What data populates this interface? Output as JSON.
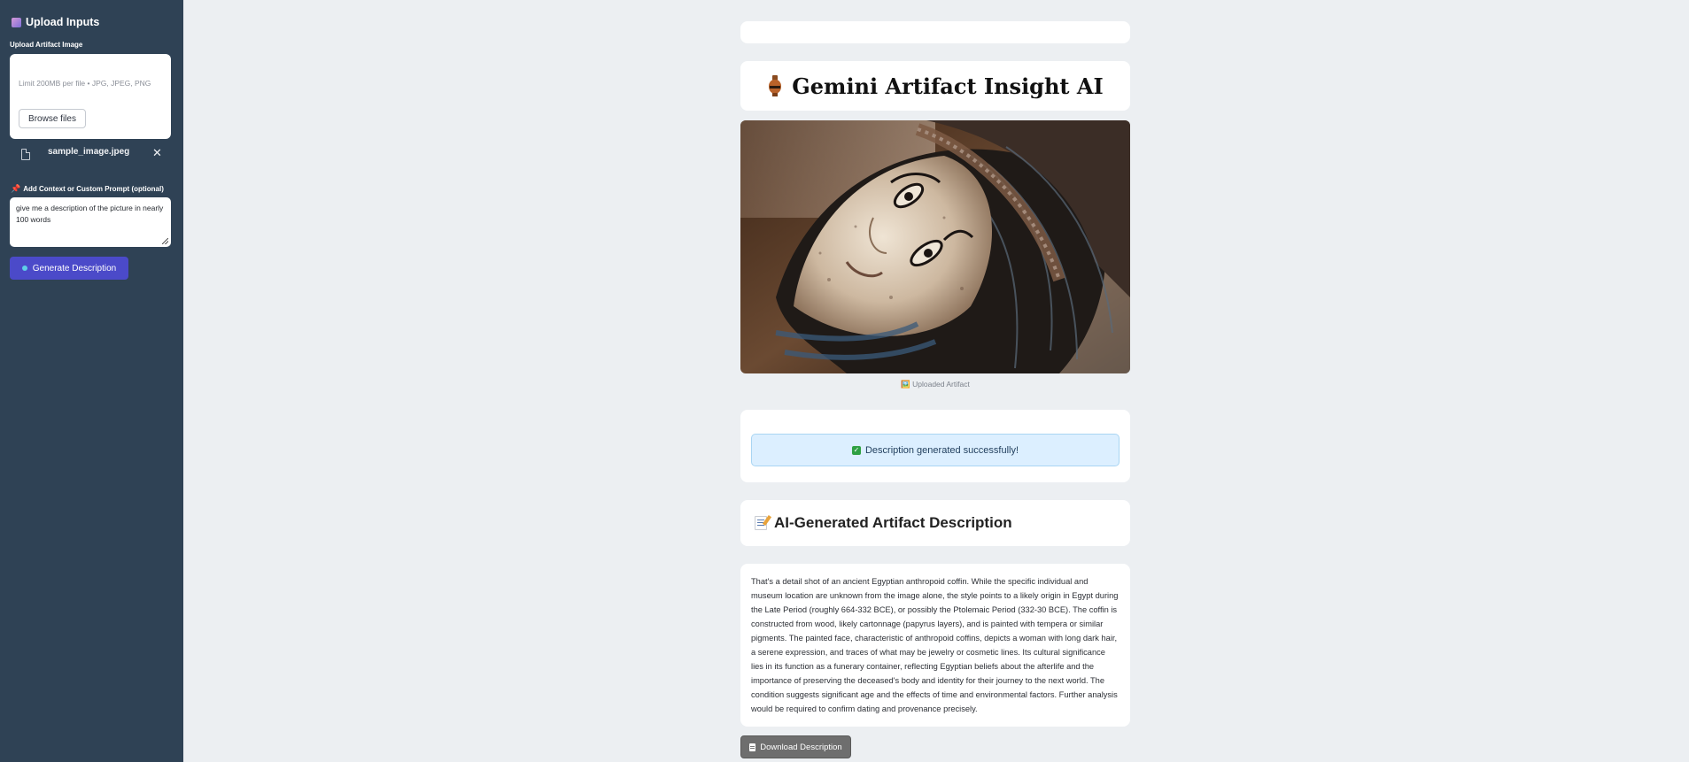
{
  "sidebar": {
    "title": "Upload Inputs",
    "upload_label": "Upload Artifact Image",
    "upload_limit": "Limit 200MB per file • JPG, JPEG, PNG",
    "browse_button": "Browse files",
    "uploaded_file": "sample_image.jpeg",
    "prompt_label": "Add Context or Custom Prompt (optional)",
    "prompt_value": "give me a description of the picture in nearly 100 words",
    "generate_button": "Generate Description"
  },
  "main": {
    "title": "Gemini Artifact Insight AI",
    "image_caption": "Uploaded Artifact",
    "success_message": "Description generated successfully!",
    "description_heading": "AI-Generated Artifact Description",
    "description_text": "That's a detail shot of an ancient Egyptian anthropoid coffin. While the specific individual and museum location are unknown from the image alone, the style points to a likely origin in Egypt during the Late Period (roughly 664-332 BCE), or possibly the Ptolemaic Period (332-30 BCE). The coffin is constructed from wood, likely cartonnage (papyrus layers), and is painted with tempera or similar pigments. The painted face, characteristic of anthropoid coffins, depicts a woman with long dark hair, a serene expression, and traces of what may be jewelry or cosmetic lines. Its cultural significance lies in its function as a funerary container, reflecting Egyptian beliefs about the afterlife and the importance of preserving the deceased's body and identity for their journey to the next world. The condition suggests significant age and the effects of time and environmental factors. Further analysis would be required to confirm dating and provenance precisely.",
    "download_button": "Download Description"
  },
  "colors": {
    "sidebar_bg": "#2f4255",
    "page_bg": "#eceff2",
    "primary_button": "#4b4ac9",
    "success_bg": "#dcefff",
    "download_button": "#6e6e6e"
  },
  "icons": [
    "amphora-icon",
    "file-icon",
    "close-icon",
    "pin-icon",
    "check-icon",
    "memo-icon",
    "document-icon"
  ]
}
